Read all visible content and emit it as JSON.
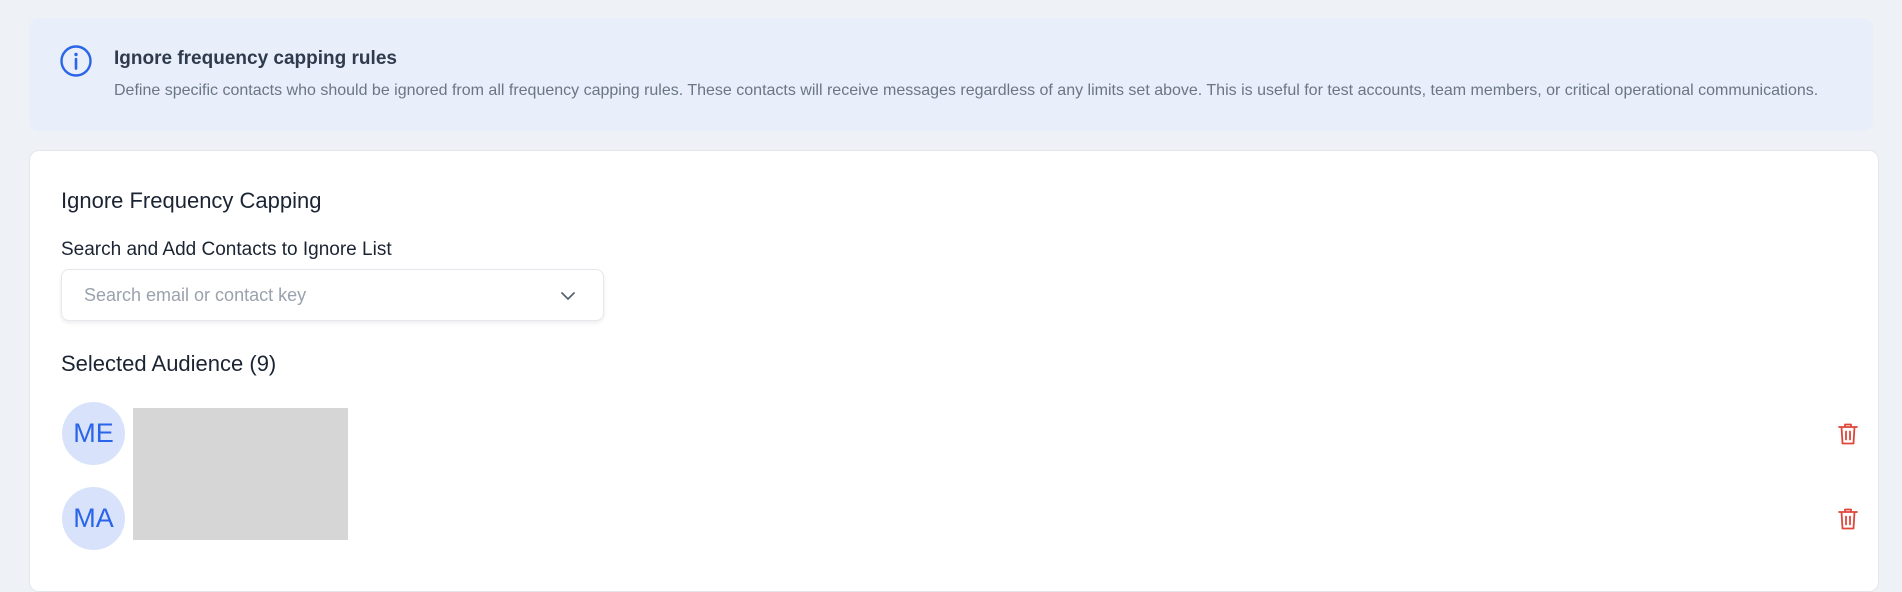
{
  "banner": {
    "icon": "info-circle-icon",
    "title": "Ignore frequency capping rules",
    "description": "Define specific contacts who should be ignored from all frequency capping rules. These contacts will receive messages regardless of any limits set above. This is useful for test accounts, team members, or critical operational communications."
  },
  "card": {
    "title": "Ignore Frequency Capping",
    "search_label": "Search and Add Contacts to Ignore List",
    "search_placeholder": "Search email or contact key",
    "audience_title": "Selected Audience (9)",
    "audience": [
      {
        "initials": "ME"
      },
      {
        "initials": "MA"
      }
    ]
  },
  "colors": {
    "accent": "#2a64e8",
    "danger": "#e0453a",
    "banner_bg": "#e8effb",
    "avatar_bg": "#d8e3fb"
  }
}
